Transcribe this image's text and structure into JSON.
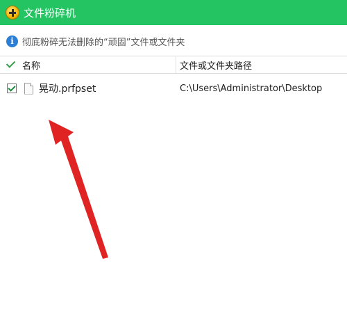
{
  "window": {
    "title": "文件粉碎机",
    "app_icon": "shredder-app-icon"
  },
  "info": {
    "icon": "info-icon",
    "glyph": "i",
    "text": "彻底粉碎无法删除的“顽固”文件或文件夹"
  },
  "table": {
    "columns": [
      "名称",
      "文件或文件夹路径"
    ],
    "header_checked": true,
    "rows": [
      {
        "checked": true,
        "name": "晃动.prfpset",
        "path": "C:\\Users\\Administrator\\Desktop",
        "icon": "file-icon"
      }
    ]
  },
  "annotation": {
    "type": "arrow",
    "color": "#e02424"
  },
  "colors": {
    "titlebar": "#25c463",
    "accent_check": "#1b8f3a",
    "info_icon": "#2a7ed6"
  }
}
